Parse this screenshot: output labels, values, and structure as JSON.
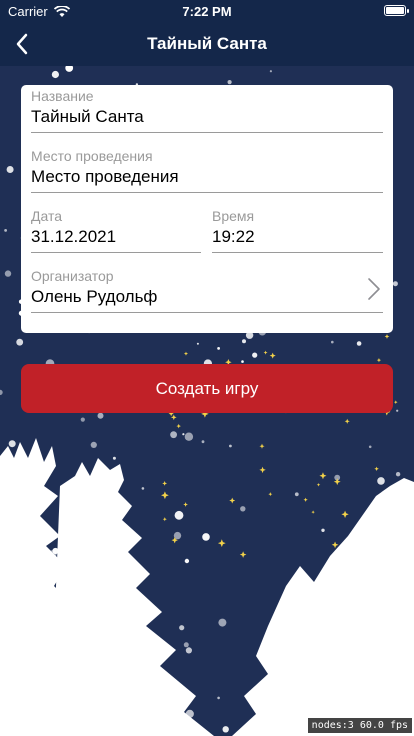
{
  "status": {
    "carrier": "Carrier",
    "time": "7:22 PM",
    "battery_level": 1.0
  },
  "nav": {
    "title": "Тайный Санта",
    "back_icon": "chevron-left-icon"
  },
  "form": {
    "name": {
      "label": "Название",
      "value": "Тайный Санта"
    },
    "venue": {
      "label": "Место проведения",
      "value": "Место проведения"
    },
    "date": {
      "label": "Дата",
      "value": "31.12.2021"
    },
    "time": {
      "label": "Время",
      "value": "19:22"
    },
    "organizer": {
      "label": "Организатор",
      "value": "Олень Рудольф",
      "icon": "chevron-right-icon"
    }
  },
  "create_button": {
    "label": "Создать игру"
  },
  "debug": {
    "text": "nodes:3  60.0 fps"
  },
  "colors": {
    "bar": "#14274a",
    "background": "#1f2f55",
    "button": "#c12128",
    "snow": "#ffffff",
    "star": "#f3d24a"
  }
}
